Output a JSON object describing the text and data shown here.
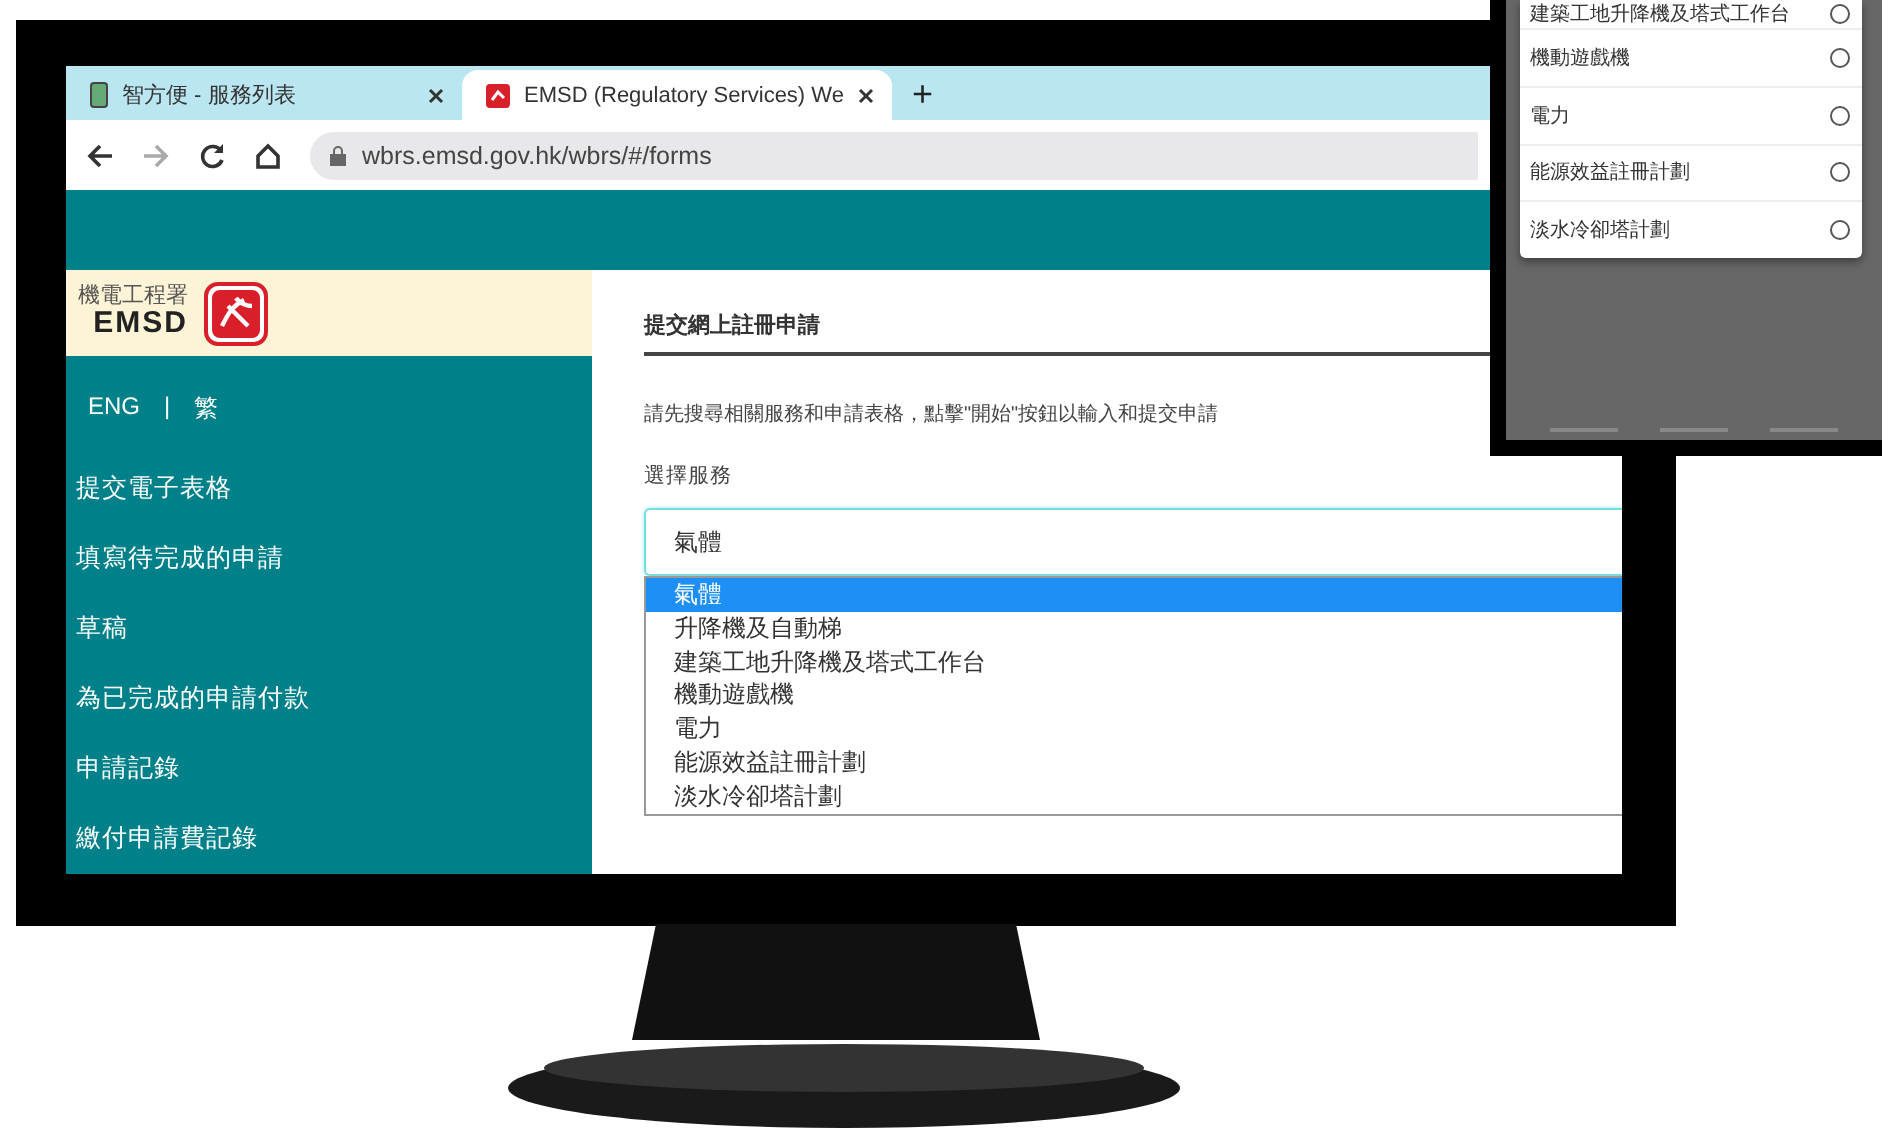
{
  "browser": {
    "tabs": [
      {
        "title": "智方便 - 服務列表",
        "selected": false
      },
      {
        "title": "EMSD (Regulatory Services) We",
        "selected": true
      }
    ],
    "new_tab": "+",
    "url": "wbrs.emsd.gov.hk/wbrs/#/forms"
  },
  "sidebar": {
    "logo_chinese": "機電工程署",
    "logo_text": "EMSD",
    "languages": [
      "ENG",
      "繁"
    ],
    "language_separator": "|",
    "items": [
      "提交電子表格",
      "填寫待完成的申請",
      "草稿",
      "為已完成的申請付款",
      "申請記錄",
      "繳付申請費記錄"
    ]
  },
  "main": {
    "title": "提交網上註冊申請",
    "description": "請先搜尋相關服務和申請表格，點擊\"開始\"按鈕以輸入和提交申請",
    "field_label": "選擇服務",
    "select": {
      "value": "氣體",
      "options": [
        {
          "label": "氣體",
          "selected": true
        },
        {
          "label": "升降機及自動梯",
          "selected": false
        },
        {
          "label": "建築工地升降機及塔式工作台",
          "selected": false
        },
        {
          "label": "機動遊戲機",
          "selected": false
        },
        {
          "label": "電力",
          "selected": false
        },
        {
          "label": "能源效益註冊計劃",
          "selected": false
        },
        {
          "label": "淡水冷卻塔計劃",
          "selected": false
        }
      ]
    }
  },
  "phone": {
    "options": [
      {
        "label": "建築工地升降機及塔式工作台",
        "selected": false
      },
      {
        "label": "機動遊戲機",
        "selected": false
      },
      {
        "label": "電力",
        "selected": false
      },
      {
        "label": "能源效益註冊計劃",
        "selected": false
      },
      {
        "label": "淡水冷卻塔計劃",
        "selected": false
      }
    ]
  }
}
